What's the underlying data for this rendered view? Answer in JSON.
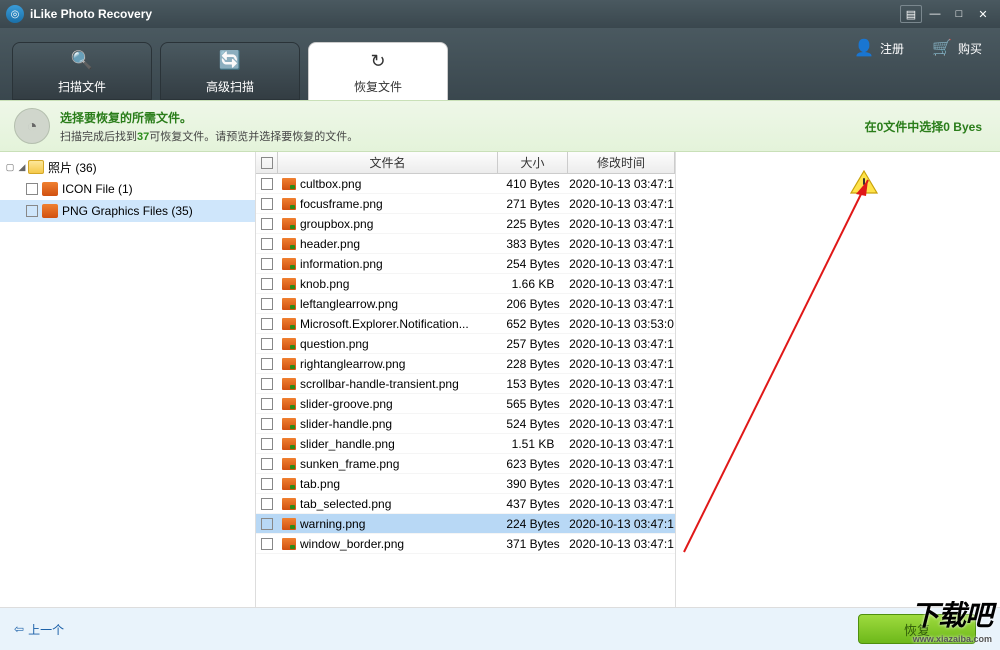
{
  "app": {
    "title": "iLike Photo Recovery"
  },
  "win": {
    "menu_glyph": "▤",
    "min_glyph": "—",
    "max_glyph": "□",
    "close_glyph": "✕"
  },
  "toolbar": {
    "tabs": [
      {
        "id": "scan",
        "label": "扫描文件",
        "icon": "🔍",
        "active": false
      },
      {
        "id": "advanced",
        "label": "高级扫描",
        "icon": "🔄",
        "active": false
      },
      {
        "id": "recover",
        "label": "恢复文件",
        "icon": "↻",
        "active": true
      }
    ],
    "register": {
      "label": "注册",
      "icon": "👤"
    },
    "purchase": {
      "label": "购买",
      "icon": "🛒"
    }
  },
  "info": {
    "headline": "选择要恢复的所需文件。",
    "prefix": "扫描完成后找到",
    "count": "37",
    "suffix": "可恢复文件。请预览并选择要恢复的文件。",
    "status": "在0文件中选择0 Byes"
  },
  "tree": {
    "root": {
      "label": "照片 (36)"
    },
    "children": [
      {
        "label": "ICON File (1)",
        "selected": false
      },
      {
        "label": "PNG Graphics Files (35)",
        "selected": true
      }
    ]
  },
  "columns": {
    "name": "文件名",
    "size": "大小",
    "date": "修改时间"
  },
  "files": [
    {
      "name": "cultbox.png",
      "size": "410 Bytes",
      "date": "2020-10-13 03:47:1",
      "sel": false
    },
    {
      "name": "focusframe.png",
      "size": "271 Bytes",
      "date": "2020-10-13 03:47:1",
      "sel": false
    },
    {
      "name": "groupbox.png",
      "size": "225 Bytes",
      "date": "2020-10-13 03:47:1",
      "sel": false
    },
    {
      "name": "header.png",
      "size": "383 Bytes",
      "date": "2020-10-13 03:47:1",
      "sel": false
    },
    {
      "name": "information.png",
      "size": "254 Bytes",
      "date": "2020-10-13 03:47:1",
      "sel": false
    },
    {
      "name": "knob.png",
      "size": "1.66 KB",
      "date": "2020-10-13 03:47:1",
      "sel": false
    },
    {
      "name": "leftanglearrow.png",
      "size": "206 Bytes",
      "date": "2020-10-13 03:47:1",
      "sel": false
    },
    {
      "name": "Microsoft.Explorer.Notification...",
      "size": "652 Bytes",
      "date": "2020-10-13 03:53:0",
      "sel": false
    },
    {
      "name": "question.png",
      "size": "257 Bytes",
      "date": "2020-10-13 03:47:1",
      "sel": false
    },
    {
      "name": "rightanglearrow.png",
      "size": "228 Bytes",
      "date": "2020-10-13 03:47:1",
      "sel": false
    },
    {
      "name": "scrollbar-handle-transient.png",
      "size": "153 Bytes",
      "date": "2020-10-13 03:47:1",
      "sel": false
    },
    {
      "name": "slider-groove.png",
      "size": "565 Bytes",
      "date": "2020-10-13 03:47:1",
      "sel": false
    },
    {
      "name": "slider-handle.png",
      "size": "524 Bytes",
      "date": "2020-10-13 03:47:1",
      "sel": false
    },
    {
      "name": "slider_handle.png",
      "size": "1.51 KB",
      "date": "2020-10-13 03:47:1",
      "sel": false
    },
    {
      "name": "sunken_frame.png",
      "size": "623 Bytes",
      "date": "2020-10-13 03:47:1",
      "sel": false
    },
    {
      "name": "tab.png",
      "size": "390 Bytes",
      "date": "2020-10-13 03:47:1",
      "sel": false
    },
    {
      "name": "tab_selected.png",
      "size": "437 Bytes",
      "date": "2020-10-13 03:47:1",
      "sel": false
    },
    {
      "name": "warning.png",
      "size": "224 Bytes",
      "date": "2020-10-13 03:47:1",
      "sel": true
    },
    {
      "name": "window_border.png",
      "size": "371 Bytes",
      "date": "2020-10-13 03:47:1",
      "sel": false
    }
  ],
  "footer": {
    "back": "上一个",
    "recover": "恢复"
  },
  "watermark": {
    "main": "下载吧",
    "sub": "www.xiazaiba.com"
  }
}
